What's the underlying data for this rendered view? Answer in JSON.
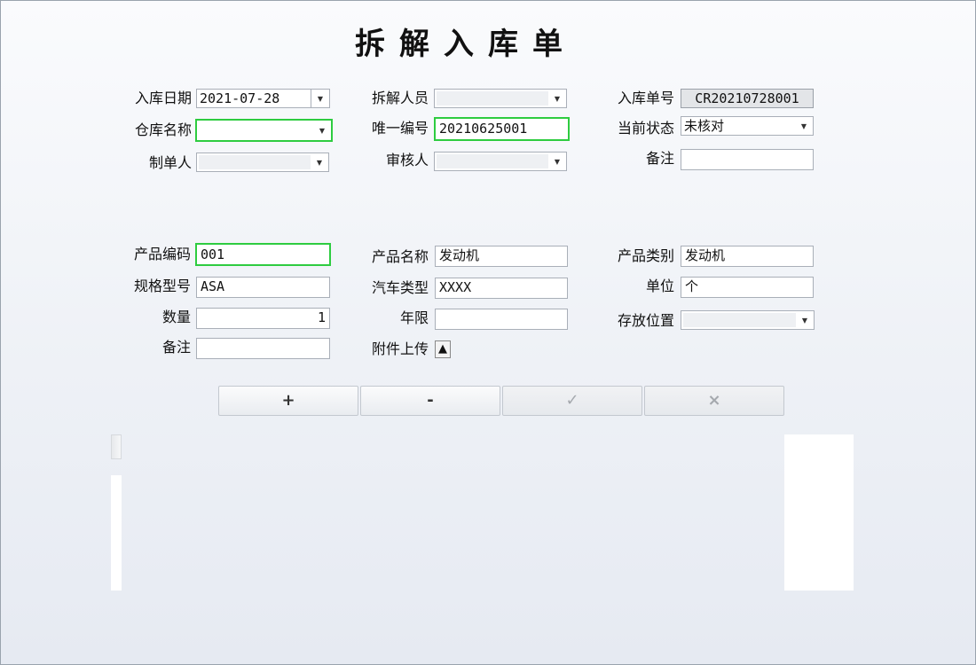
{
  "title": "拆解入库单",
  "header": {
    "inbound_date": {
      "label": "入库日期",
      "value": "2021-07-28"
    },
    "disassembler": {
      "label": "拆解人员",
      "value": ""
    },
    "inbound_no": {
      "label": "入库单号",
      "value": "CR20210728001"
    },
    "warehouse": {
      "label": "仓库名称",
      "value": ""
    },
    "unique_no": {
      "label": "唯一编号",
      "value": "20210625001"
    },
    "status": {
      "label": "当前状态",
      "value": "未核对"
    },
    "creator": {
      "label": "制单人",
      "value": ""
    },
    "reviewer": {
      "label": "审核人",
      "value": ""
    },
    "remark": {
      "label": "备注",
      "value": ""
    }
  },
  "product": {
    "code": {
      "label": "产品编码",
      "value": "001"
    },
    "name": {
      "label": "产品名称",
      "value": "发动机"
    },
    "category": {
      "label": "产品类别",
      "value": "发动机"
    },
    "spec": {
      "label": "规格型号",
      "value": "ASA"
    },
    "car_type": {
      "label": "汽车类型",
      "value": "XXXX"
    },
    "unit": {
      "label": "单位",
      "value": "个"
    },
    "quantity": {
      "label": "数量",
      "value": "1"
    },
    "years": {
      "label": "年限",
      "value": ""
    },
    "location": {
      "label": "存放位置",
      "value": ""
    },
    "remark": {
      "label": "备注",
      "value": ""
    },
    "attachment": {
      "label": "附件上传",
      "icon": "▲"
    }
  },
  "toolbar": {
    "add": "+",
    "remove": "-",
    "confirm": "✓",
    "cancel": "×"
  },
  "icons": {
    "dropdown": "▼"
  }
}
